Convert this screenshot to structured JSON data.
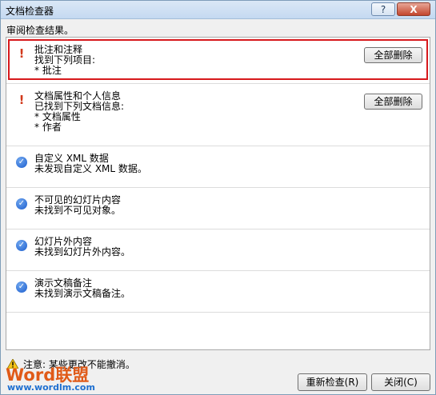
{
  "window": {
    "title": "文档检查器",
    "help_icon": "?",
    "close_icon": "X"
  },
  "header": "审阅检查结果。",
  "sections": [
    {
      "status": "warning",
      "lines": [
        "批注和注释",
        "找到下列项目:",
        "* 批注"
      ],
      "button": "全部删除"
    },
    {
      "status": "warning",
      "lines": [
        "文档属性和个人信息",
        "已找到下列文档信息:",
        "* 文档属性",
        "* 作者"
      ],
      "button": "全部删除"
    },
    {
      "status": "ok",
      "lines": [
        "自定义 XML 数据",
        "未发现自定义 XML 数据。"
      ]
    },
    {
      "status": "ok",
      "lines": [
        "不可见的幻灯片内容",
        "未找到不可见对象。"
      ]
    },
    {
      "status": "ok",
      "lines": [
        "幻灯片外内容",
        "未找到幻灯片外内容。"
      ]
    },
    {
      "status": "ok",
      "lines": [
        "演示文稿备注",
        "未找到演示文稿备注。"
      ]
    }
  ],
  "footer": {
    "note": "注意: 某些更改不能撤消。",
    "reinspect_button": "重新检查(R)",
    "close_button": "关闭(C)"
  },
  "watermark": {
    "logo_text": "Word联盟",
    "url": "www.wordlm.com"
  },
  "colors": {
    "highlight_border": "#d7191c",
    "warning_icon": "#d2391b",
    "check_icon": "#1d5fcf"
  },
  "icons": {
    "warning": "exclamation-icon",
    "ok": "check-circle-icon"
  }
}
